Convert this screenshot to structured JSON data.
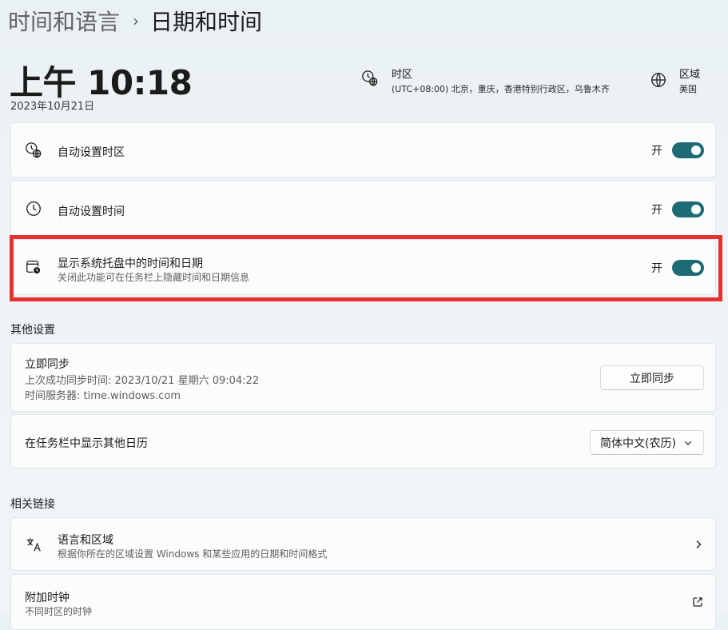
{
  "breadcrumb": {
    "parent": "时间和语言",
    "separator": "›",
    "current": "日期和时间"
  },
  "clock": {
    "time": "上午 10:18",
    "date": "2023年10月21日"
  },
  "timezone_info": {
    "title": "时区",
    "value": "(UTC+08:00) 北京，重庆，香港特别行政区，乌鲁木齐",
    "icon": "clock-globe-icon"
  },
  "region_info": {
    "title": "区域",
    "value": "美国",
    "icon": "globe-icon"
  },
  "settings": {
    "auto_timezone": {
      "label": "自动设置时区",
      "state": "开",
      "icon": "clock-globe-icon"
    },
    "auto_time": {
      "label": "自动设置时间",
      "state": "开",
      "icon": "clock-icon"
    },
    "tray_time": {
      "label": "显示系统托盘中的时间和日期",
      "description": "关闭此功能可在任务栏上隐藏时间和日期信息",
      "state": "开",
      "icon": "calendar-clock-icon"
    }
  },
  "other_settings": {
    "heading": "其他设置",
    "sync": {
      "title": "立即同步",
      "last_sync": "上次成功同步时间: 2023/10/21 星期六 09:04:22",
      "server": "时间服务器: time.windows.com",
      "button": "立即同步"
    },
    "calendar": {
      "label": "在任务栏中显示其他日历",
      "selected": "简体中文(农历)"
    }
  },
  "related_links": {
    "heading": "相关链接",
    "language_region": {
      "title": "语言和区域",
      "description": "根据你所在的区域设置 Windows 和某些应用的日期和时间格式",
      "icon": "language-icon"
    },
    "additional_clocks": {
      "title": "附加时钟",
      "description": "不同时区的时钟",
      "icon": "external-link-icon"
    }
  },
  "colors": {
    "accent": "#1f6b75",
    "highlight": "#e5312f"
  }
}
